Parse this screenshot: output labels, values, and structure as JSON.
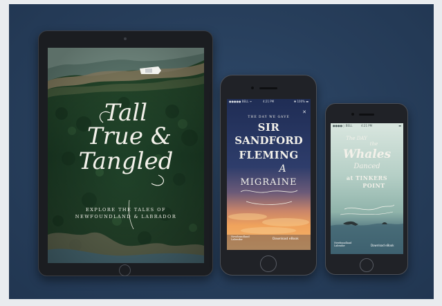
{
  "scene": {
    "background_color": "#e9ecef",
    "panel_color": "#2a4262",
    "device_frame_color": "#1c1e22"
  },
  "tablet": {
    "title_lines": [
      "Tall",
      "True &",
      "Tangled"
    ],
    "tagline_1": "EXPLORE THE TALES OF",
    "tagline_2": "NEWFOUNDLAND & LABRADOR"
  },
  "phone_1": {
    "status": {
      "carrier": "●●●●● BELL ᯤ",
      "time": "4:21 PM",
      "battery": "✱ 100% ▬"
    },
    "close_icon": "✕",
    "kicker": "THE DAY WE GAVE",
    "title_lines": [
      "SIR",
      "SANDFORD",
      "FLEMING"
    ],
    "connector": "A",
    "subtitle": "MIGRAINE",
    "brand": "Newfoundland Labrador",
    "footer_link": "Download eBook"
  },
  "phone_2": {
    "status": {
      "carrier": "●●●●○ BELL",
      "time": "4:21 PM",
      "battery": "▬"
    },
    "title_lines": [
      "The DAY",
      "the",
      "Whales",
      "Danced",
      "at TINKERS",
      "POINT"
    ],
    "brand": "Newfoundland Labrador",
    "footer_link": "Download eBook"
  },
  "icons": [
    "close-icon",
    "home-button-icon",
    "camera-icon",
    "speaker-icon",
    "whale-tail-icon",
    "cloud-icon"
  ]
}
